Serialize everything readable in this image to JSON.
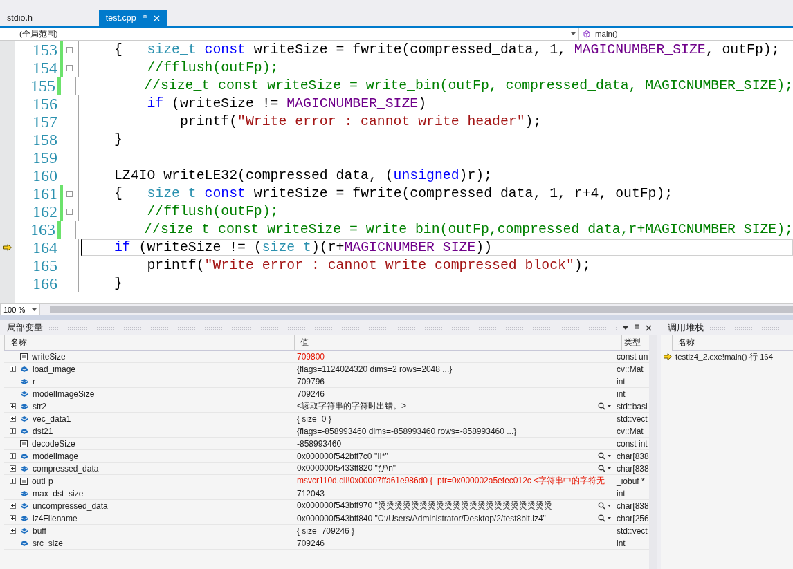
{
  "tabs": [
    {
      "label": "stdio.h",
      "selected": false
    },
    {
      "label": "test.cpp",
      "selected": true
    }
  ],
  "nav": {
    "scope": "(全局范围)",
    "function": "main()"
  },
  "editor": {
    "zoom": "100 %",
    "lines": [
      {
        "number": "153",
        "changed": true,
        "fold": true,
        "current": false,
        "code": [
          {
            "kind": "plain",
            "text": "{   "
          },
          {
            "kind": "type",
            "text": "size_t"
          },
          {
            "kind": "kw",
            "text": " const"
          },
          {
            "kind": "plain",
            "text": " writeSize = fwrite(compressed_data, 1, "
          },
          {
            "kind": "macro",
            "text": "MAGICNUMBER_SIZE"
          },
          {
            "kind": "plain",
            "text": ", outFp);"
          }
        ]
      },
      {
        "number": "154",
        "changed": true,
        "fold": true,
        "current": false,
        "code": [
          {
            "kind": "comment",
            "text": "    //fflush(outFp);"
          }
        ]
      },
      {
        "number": "155",
        "changed": true,
        "fold": false,
        "current": false,
        "code": [
          {
            "kind": "comment",
            "text": "    //size_t const writeSize = write_bin(outFp, compressed_data, MAGICNUMBER_SIZE);"
          }
        ]
      },
      {
        "number": "156",
        "changed": false,
        "fold": false,
        "current": false,
        "code": [
          {
            "kind": "kw",
            "text": "    if"
          },
          {
            "kind": "plain",
            "text": " (writeSize != "
          },
          {
            "kind": "macro",
            "text": "MAGICNUMBER_SIZE"
          },
          {
            "kind": "plain",
            "text": ")"
          }
        ]
      },
      {
        "number": "157",
        "changed": false,
        "fold": false,
        "current": false,
        "code": [
          {
            "kind": "plain",
            "text": "        printf("
          },
          {
            "kind": "str",
            "text": "\"Write error : cannot write header\""
          },
          {
            "kind": "plain",
            "text": ");"
          }
        ]
      },
      {
        "number": "158",
        "changed": false,
        "fold": false,
        "current": false,
        "code": [
          {
            "kind": "plain",
            "text": "}"
          }
        ]
      },
      {
        "number": "159",
        "changed": false,
        "fold": false,
        "current": false
      },
      {
        "number": "160",
        "changed": false,
        "fold": false,
        "current": false,
        "code": [
          {
            "kind": "plain",
            "text": "LZ4IO_writeLE32(compressed_data, ("
          },
          {
            "kind": "kw",
            "text": "unsigned"
          },
          {
            "kind": "plain",
            "text": ")r);"
          }
        ]
      },
      {
        "number": "161",
        "changed": true,
        "fold": true,
        "current": false,
        "code": [
          {
            "kind": "plain",
            "text": "{   "
          },
          {
            "kind": "type",
            "text": "size_t"
          },
          {
            "kind": "kw",
            "text": " const"
          },
          {
            "kind": "plain",
            "text": " writeSize = fwrite(compressed_data, 1, r+4, outFp);"
          }
        ]
      },
      {
        "number": "162",
        "changed": true,
        "fold": true,
        "current": false,
        "code": [
          {
            "kind": "comment",
            "text": "    //fflush(outFp);"
          }
        ]
      },
      {
        "number": "163",
        "changed": true,
        "fold": false,
        "current": false,
        "code": [
          {
            "kind": "comment",
            "text": "    //size_t const writeSize = write_bin(outFp,compressed_data,r+MAGICNUMBER_SIZE);"
          }
        ]
      },
      {
        "number": "164",
        "changed": false,
        "fold": false,
        "current": true,
        "code": [
          {
            "kind": "kw",
            "text": "if"
          },
          {
            "kind": "plain",
            "text": " (writeSize != ("
          },
          {
            "kind": "type",
            "text": "size_t"
          },
          {
            "kind": "plain",
            "text": ")(r+"
          },
          {
            "kind": "macro",
            "text": "MAGICNUMBER_SIZE"
          },
          {
            "kind": "plain",
            "text": "))"
          }
        ]
      },
      {
        "number": "165",
        "changed": false,
        "fold": false,
        "current": false,
        "code": [
          {
            "kind": "plain",
            "text": "    printf("
          },
          {
            "kind": "str",
            "text": "\"Write error : cannot write compressed block\""
          },
          {
            "kind": "plain",
            "text": ");"
          }
        ]
      },
      {
        "number": "166",
        "changed": false,
        "fold": false,
        "current": false,
        "code": [
          {
            "kind": "plain",
            "text": "}"
          }
        ]
      }
    ]
  },
  "locals": {
    "title": "局部变量",
    "columns": [
      "名称",
      "值",
      "类型"
    ],
    "rows": [
      {
        "name": "writeSize",
        "value": "709800",
        "type": "const un",
        "kind": "const",
        "expandable": false,
        "changed": true,
        "viewer": false
      },
      {
        "name": "load_image",
        "value": "{flags=1124024320 dims=2 rows=2048 ...}",
        "type": "cv::Mat",
        "kind": "object",
        "expandable": true,
        "changed": false,
        "viewer": false
      },
      {
        "name": "r",
        "value": "709796",
        "type": "int",
        "kind": "object",
        "expandable": false,
        "changed": false,
        "viewer": false
      },
      {
        "name": "modelImageSize",
        "value": "709246",
        "type": "int",
        "kind": "object",
        "expandable": false,
        "changed": false,
        "viewer": false
      },
      {
        "name": "str2",
        "value": "<读取字符串的字符时出错。>",
        "type": "std::basi",
        "kind": "object",
        "expandable": true,
        "changed": false,
        "viewer": true
      },
      {
        "name": "vec_data1",
        "value": "{ size=0 }",
        "type": "std::vect",
        "kind": "object",
        "expandable": true,
        "changed": false,
        "viewer": false
      },
      {
        "name": "dst21",
        "value": "{flags=-858993460 dims=-858993460 rows=-858993460 ...}",
        "type": "cv::Mat",
        "kind": "object",
        "expandable": true,
        "changed": false,
        "viewer": false
      },
      {
        "name": "decodeSize",
        "value": "-858993460",
        "type": "const int",
        "kind": "const",
        "expandable": false,
        "changed": false,
        "viewer": false
      },
      {
        "name": "modelImage",
        "value": "0x000000f542bff7c0 \"II*\"",
        "type": "char[838",
        "kind": "object",
        "expandable": true,
        "changed": false,
        "viewer": true
      },
      {
        "name": "compressed_data",
        "value": "0x000000f5433ff820 \"び\\n\"",
        "type": "char[838",
        "kind": "object",
        "expandable": true,
        "changed": false,
        "viewer": true
      },
      {
        "name": "outFp",
        "value": "msvcr110d.dll!0x00007ffa61e986d0 {_ptr=0x000002a5efec012c <字符串中的字符无",
        "type": "_iobuf *",
        "kind": "const",
        "expandable": true,
        "changed": true,
        "viewer": false
      },
      {
        "name": "max_dst_size",
        "value": "712043",
        "type": "int",
        "kind": "object",
        "expandable": false,
        "changed": false,
        "viewer": false
      },
      {
        "name": "uncompressed_data",
        "value": "0x000000f543bff970 \"烫烫烫烫烫烫烫烫烫烫烫烫烫烫烫烫烫烫烫烫烫",
        "type": "char[838",
        "kind": "object",
        "expandable": true,
        "changed": false,
        "viewer": true
      },
      {
        "name": "lz4Filename",
        "value": "0x000000f543bff840 \"C:/Users/Administrator/Desktop/2/test8bit.lz4\"",
        "type": "char[256",
        "kind": "object",
        "expandable": true,
        "changed": false,
        "viewer": true
      },
      {
        "name": "buff",
        "value": "{ size=709246 }",
        "type": "std::vect",
        "kind": "object",
        "expandable": true,
        "changed": false,
        "viewer": false
      },
      {
        "name": "src_size",
        "value": "709246",
        "type": "int",
        "kind": "object",
        "expandable": false,
        "changed": false,
        "viewer": false
      }
    ]
  },
  "callstack": {
    "title": "调用堆栈",
    "column": "名称",
    "frames": [
      {
        "text": "testlz4_2.exe!main() 行 164",
        "current": true
      }
    ]
  }
}
